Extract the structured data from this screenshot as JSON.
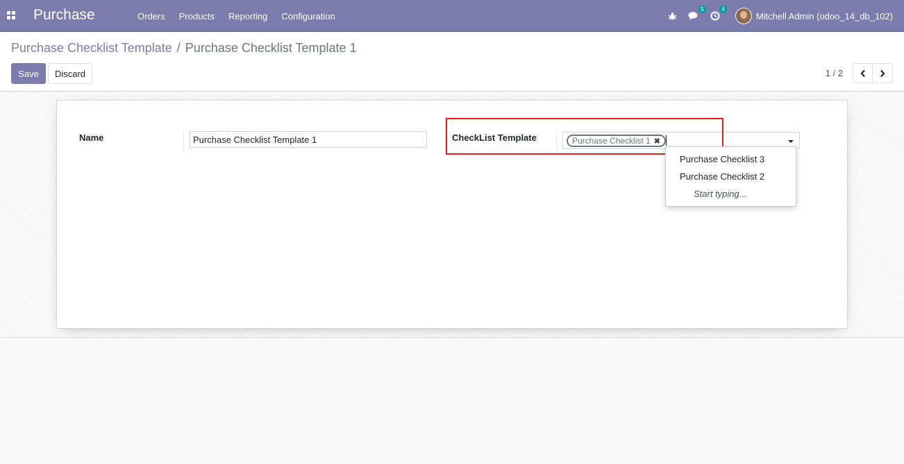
{
  "navbar": {
    "app_name": "Purchase",
    "menu": [
      "Orders",
      "Products",
      "Reporting",
      "Configuration"
    ],
    "messages_count": "5",
    "activities_count": "4",
    "user_name": "Mitchell Admin (odoo_14_db_102)",
    "icons": [
      "apps-icon",
      "bug-icon",
      "chat-icon",
      "clock-icon"
    ],
    "accent_color": "#7c7bad",
    "badge_color": "#00a09d"
  },
  "control_panel": {
    "breadcrumb_parent": "Purchase Checklist Template",
    "breadcrumb_separator": "/",
    "breadcrumb_current": "Purchase Checklist Template 1",
    "save_label": "Save",
    "discard_label": "Discard",
    "pager": "1 / 2"
  },
  "form": {
    "name_label": "Name",
    "name_value": "Purchase Checklist Template 1",
    "checklist_label": "CheckList Template",
    "selected_tags": [
      "Purchase Checklist 1"
    ],
    "dropdown_options": [
      "Purchase Checklist 3",
      "Purchase Checklist 2"
    ],
    "dropdown_more": "Start typing...",
    "highlight_color": "#e11d1d"
  }
}
